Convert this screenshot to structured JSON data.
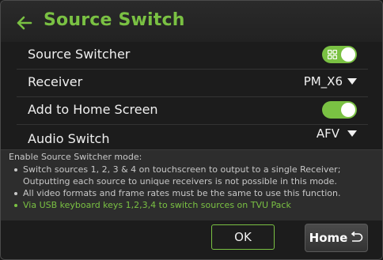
{
  "header": {
    "title": "Source Switch",
    "back_icon": "arrow-left-icon",
    "accent_color": "#7ac143"
  },
  "settings": {
    "source_switcher": {
      "label": "Source Switcher",
      "enabled": true
    },
    "receiver": {
      "label": "Receiver",
      "value": "PM_X6"
    },
    "add_to_home": {
      "label": "Add to Home Screen",
      "enabled": true
    },
    "audio_switch": {
      "label": "Audio Switch",
      "value": "AFV"
    }
  },
  "info": {
    "heading": "Enable Source Switcher mode:",
    "bullets": [
      "Switch sources 1, 2, 3 & 4 on touchscreen to output to a single Receiver;",
      "Outputting each source to unique receivers is not possible in this mode.",
      "All video formats and frame rates must be the same to use this function.",
      "Via USB keyboard keys 1,2,3,4 to switch sources on TVU Pack"
    ]
  },
  "footer": {
    "ok_label": "OK",
    "home_label": "Home",
    "home_icon": "return-icon"
  }
}
